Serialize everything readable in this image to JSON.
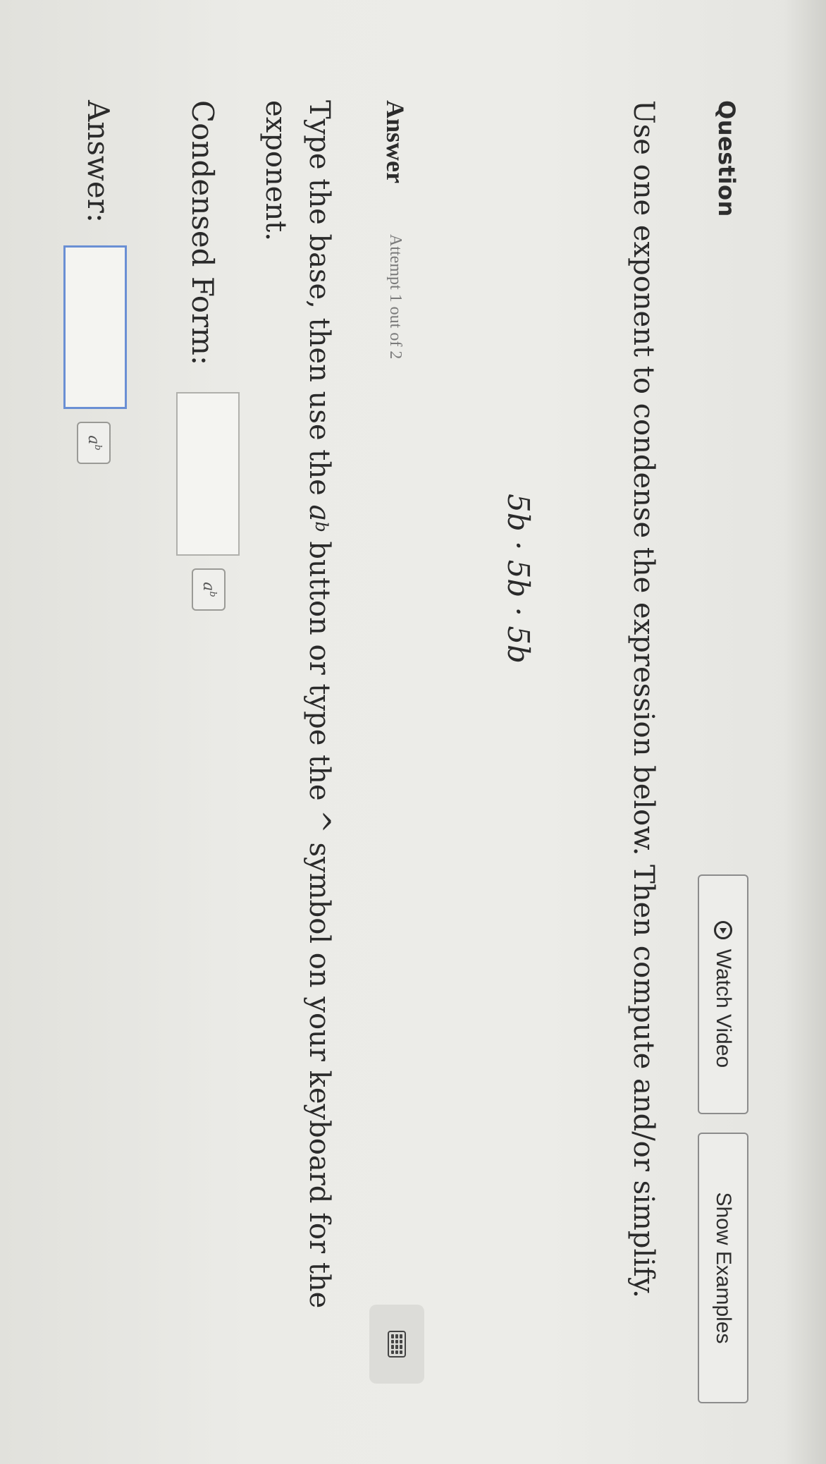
{
  "question": {
    "label": "Question",
    "watch_video_label": "Watch Video",
    "show_examples_label": "Show Examples",
    "instruction": "Use one exponent to condense the expression below. Then compute and/or simplify.",
    "expression": "5b · 5b · 5b"
  },
  "answer": {
    "label": "Answer",
    "attempt": "Attempt 1 out of 2",
    "hint_part1": "Type the base, then use the",
    "hint_button_base": "a",
    "hint_button_exp": "b",
    "hint_part2": "button or type the ^ symbol on your keyboard for the exponent.",
    "condensed_label": "Condensed Form:",
    "answer_label": "Answer:",
    "condensed_value": "",
    "answer_value": "",
    "exp_button_base": "a",
    "exp_button_exp": "b"
  },
  "icons": {
    "play": "play-circle-icon",
    "keyboard": "keyboard-icon"
  }
}
